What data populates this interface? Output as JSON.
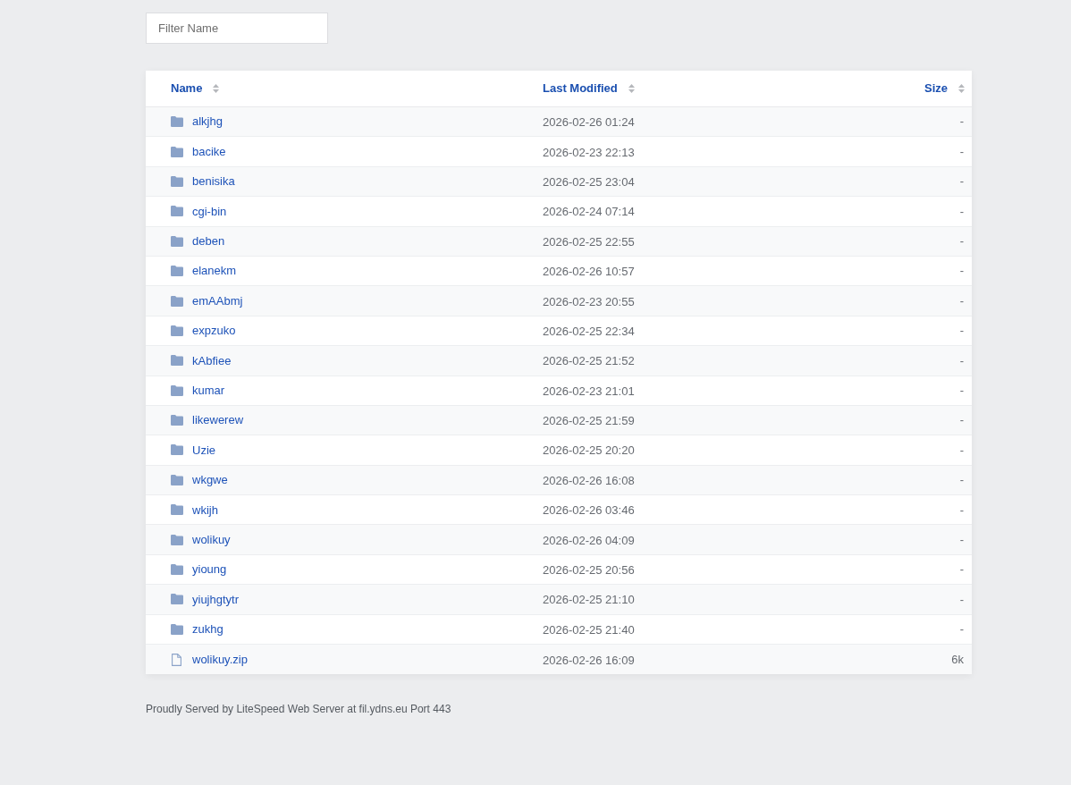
{
  "filter": {
    "placeholder": "Filter Name"
  },
  "table": {
    "columns": [
      {
        "label": "Name"
      },
      {
        "label": "Last Modified"
      },
      {
        "label": "Size"
      }
    ],
    "rows": [
      {
        "kind": "folder",
        "name": "alkjhg",
        "modified": "2026-02-26 01:24",
        "size": "-"
      },
      {
        "kind": "folder",
        "name": "bacike",
        "modified": "2026-02-23 22:13",
        "size": "-"
      },
      {
        "kind": "folder",
        "name": "benisika",
        "modified": "2026-02-25 23:04",
        "size": "-"
      },
      {
        "kind": "folder",
        "name": "cgi-bin",
        "modified": "2026-02-24 07:14",
        "size": "-"
      },
      {
        "kind": "folder",
        "name": "deben",
        "modified": "2026-02-25 22:55",
        "size": "-"
      },
      {
        "kind": "folder",
        "name": "elanekm",
        "modified": "2026-02-26 10:57",
        "size": "-"
      },
      {
        "kind": "folder",
        "name": "emAAbmj",
        "modified": "2026-02-23 20:55",
        "size": "-"
      },
      {
        "kind": "folder",
        "name": "expzuko",
        "modified": "2026-02-25 22:34",
        "size": "-"
      },
      {
        "kind": "folder",
        "name": "kAbfiee",
        "modified": "2026-02-25 21:52",
        "size": "-"
      },
      {
        "kind": "folder",
        "name": "kumar",
        "modified": "2026-02-23 21:01",
        "size": "-"
      },
      {
        "kind": "folder",
        "name": "likewerew",
        "modified": "2026-02-25 21:59",
        "size": "-"
      },
      {
        "kind": "folder",
        "name": "Uzie",
        "modified": "2026-02-25 20:20",
        "size": "-"
      },
      {
        "kind": "folder",
        "name": "wkgwe",
        "modified": "2026-02-26 16:08",
        "size": "-"
      },
      {
        "kind": "folder",
        "name": "wkijh",
        "modified": "2026-02-26 03:46",
        "size": "-"
      },
      {
        "kind": "folder",
        "name": "wolikuy",
        "modified": "2026-02-26 04:09",
        "size": "-"
      },
      {
        "kind": "folder",
        "name": "yioung",
        "modified": "2026-02-25 20:56",
        "size": "-"
      },
      {
        "kind": "folder",
        "name": "yiujhgtytr",
        "modified": "2026-02-25 21:10",
        "size": "-"
      },
      {
        "kind": "folder",
        "name": "zukhg",
        "modified": "2026-02-25 21:40",
        "size": "-"
      },
      {
        "kind": "file",
        "name": "wolikuy.zip",
        "modified": "2026-02-26 16:09",
        "size": "6k"
      }
    ]
  },
  "footer": "Proudly Served by LiteSpeed Web Server at fil.ydns.eu Port 443"
}
